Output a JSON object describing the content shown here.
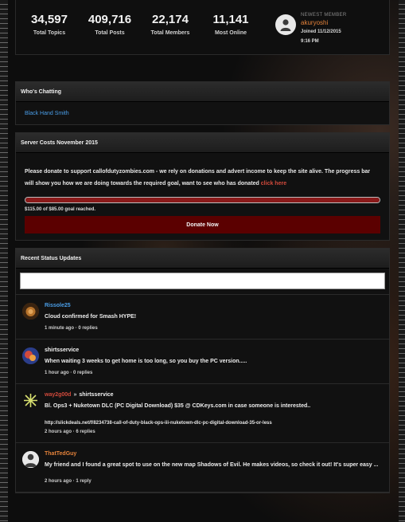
{
  "stats": [
    {
      "value": "34,597",
      "label": "Total Topics"
    },
    {
      "value": "409,716",
      "label": "Total Posts"
    },
    {
      "value": "22,174",
      "label": "Total Members"
    },
    {
      "value": "11,141",
      "label": "Most Online"
    }
  ],
  "newest_member": {
    "caption": "NEWEST MEMBER",
    "username": "akuryoshi",
    "joined_line1": "Joined 11/12/2015",
    "joined_line2": "9:16 PM"
  },
  "whos_chatting": {
    "title": "Who's Chatting",
    "users": [
      "Black Hand Smith"
    ]
  },
  "server_costs": {
    "title": "Server Costs November 2015",
    "message": "Please donate to support callofdutyzombies.com - we rely on donations and advert income to keep the site alive. The progress bar will show you how we are doing towards the required goal, want to see who has donated",
    "link_label": "click here",
    "progress_fraction": 1.0,
    "reached_text": "$115.00 of $85.00 goal reached.",
    "donate_label": "Donate Now"
  },
  "status_updates": {
    "title": "Recent Status Updates",
    "input_value": "",
    "items": [
      {
        "author": "Rissole25",
        "target": "",
        "text": "Cloud confirmed for Smash HYPE!",
        "link": "",
        "meta": "1 minute ago · 0 replies"
      },
      {
        "author": "shirtsservice",
        "target": "",
        "text": "When waiting 3 weeks to get home is too long, so you buy the PC version.....",
        "link": "",
        "meta": "1 hour ago · 0 replies"
      },
      {
        "author": "way2g00d",
        "target": "shirtsservice",
        "text": "Bl. Ops3 + Nuketown DLC (PC Digital Download) $35 @ CDKeys.com in case someone is interested..",
        "link": "http://slickdeals.net/f/8234738-call-of-duty-black-ops-iii-nuketown-dlc-pc-digital-download-35-or-less",
        "meta": "2 hours ago · 6 replies"
      },
      {
        "author": "ThatTedGuy",
        "target": "",
        "text": "My friend and I found a great spot to use on the new map Shadows of Evil. He makes videos, so check it out! It's super easy ...",
        "link": "",
        "meta": "2 hours ago · 1 reply"
      }
    ],
    "arrow": "»"
  },
  "colors": {
    "accent_orange": "#e2813a",
    "link_blue": "#4a9ee8",
    "donate_red": "#5b0000"
  }
}
